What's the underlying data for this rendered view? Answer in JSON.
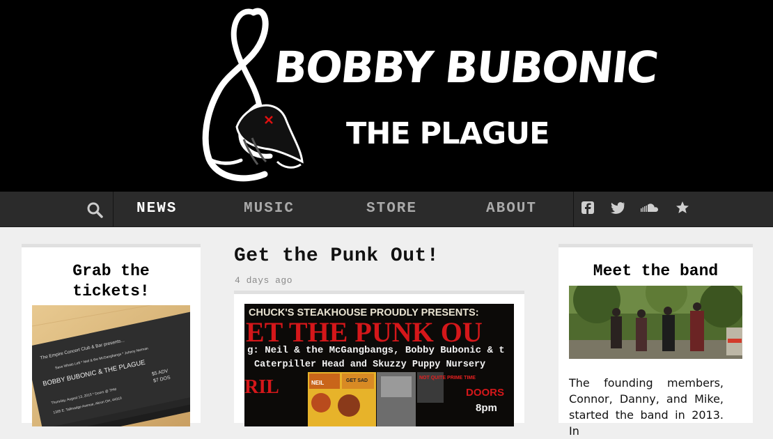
{
  "header": {
    "logo_title": "BOBBY BUBONIC",
    "logo_subtitle": "THE PLAGUE"
  },
  "nav": {
    "search_icon": "search-icon",
    "items": [
      {
        "label": "NEWS",
        "active": true
      },
      {
        "label": "MUSIC",
        "active": false
      },
      {
        "label": "STORE",
        "active": false
      },
      {
        "label": "ABOUT",
        "active": false
      }
    ],
    "social_icons": [
      "facebook-icon",
      "twitter-icon",
      "soundcloud-icon",
      "star-icon"
    ]
  },
  "left": {
    "title": "Grab the tickets!",
    "ticket": {
      "presenter": "The Empire Concert Club & Bar presents...",
      "lineup": "Save Whats Left * Neil & the McGangbangs * Johnny Neiman",
      "headliner": "BOBBY BUBONIC & THE PLAGUE",
      "price_adv": "$5 ADV",
      "price_dos": "$7 DOS",
      "date": "Thursday, August 13, 2015 * Doors @ 7PM",
      "address": "1305 E. Tallmadge Avenue, Akron OH, 44310"
    }
  },
  "post": {
    "title": "Get the Punk Out!",
    "date": "4 days ago",
    "poster": {
      "presenter": "CHUCK'S STEAKHOUSE PROUDLY PRESENTS:",
      "headline": "ET THE PUNK OU",
      "bands_line1": "g: Neil & the McGangbangs, Bobby Bubonic & t",
      "bands_line2": "Caterpiller Head and Skuzzy Puppy Nursery",
      "month_fragment": "RIL",
      "doors_label": "DOORS",
      "doors_time": "8pm",
      "sticker_text": "NOT QUITE PRIME TIME",
      "comic_words": [
        "NEIL",
        "GET SAD"
      ]
    }
  },
  "right": {
    "title": "Meet the band",
    "about": "The founding members, Connor, Danny, and Mike, started the band in 2013. In"
  },
  "colors": {
    "banner_bg": "#000000",
    "nav_bg": "#2b2b2b",
    "page_bg": "#efefef",
    "poster_red": "#d4171a"
  }
}
